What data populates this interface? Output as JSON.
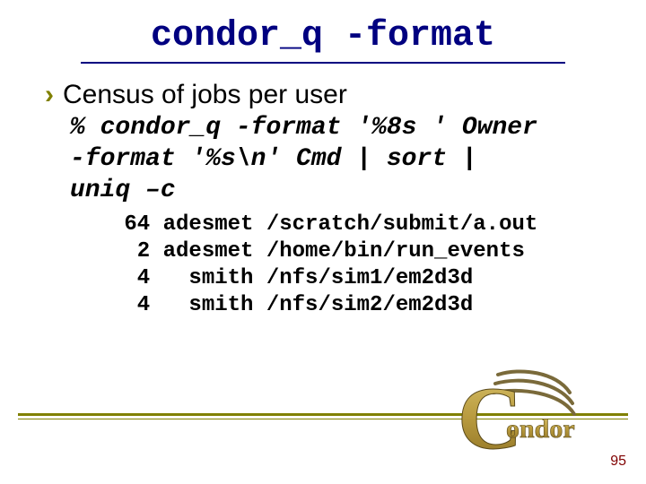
{
  "title": "condor_q -format",
  "bullet": "Census of jobs per user",
  "command": {
    "prompt": "%",
    "line1": "condor_q -format '%8s ' Owner",
    "line2": "-format '%s\\n' Cmd | sort |",
    "line3": "uniq –c"
  },
  "output_rows": [
    {
      "count": "64",
      "user": "adesmet",
      "path": "/scratch/submit/a.out"
    },
    {
      "count": "2",
      "user": "adesmet",
      "path": "/home/bin/run_events"
    },
    {
      "count": "4",
      "user": "smith",
      "path": "/nfs/sim1/em2d3d"
    },
    {
      "count": "4",
      "user": "smith",
      "path": "/nfs/sim2/em2d3d"
    }
  ],
  "logo_text": "ondor",
  "page_number": "95"
}
